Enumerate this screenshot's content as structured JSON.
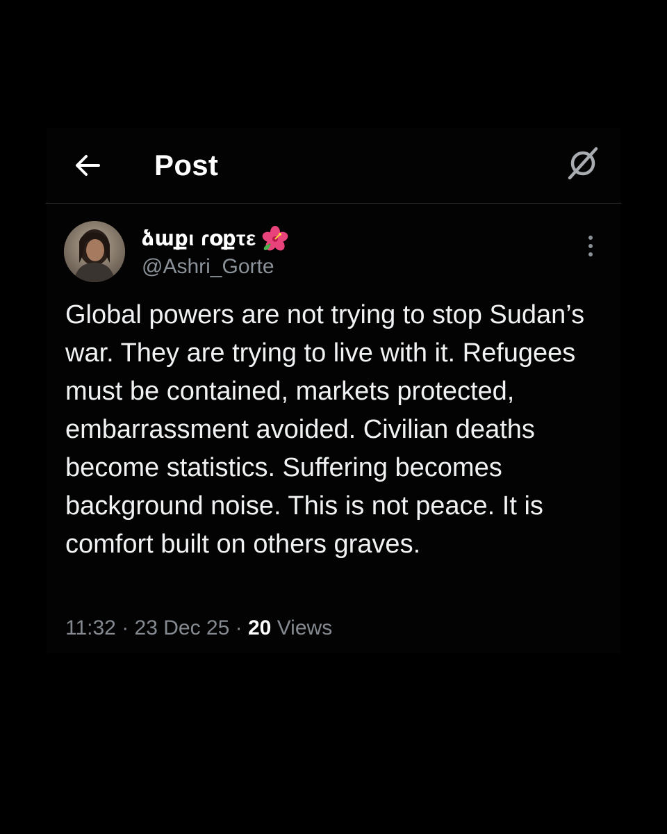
{
  "header": {
    "title": "Post",
    "back_icon": "arrow-left-icon",
    "grok_icon": "grok-icon"
  },
  "post": {
    "author": {
      "display_name": "ձաքι ɾօքτε",
      "emoji_icon": "hibiscus-icon",
      "handle": "@Ashri_Gorte"
    },
    "more_icon": "more-vertical-icon",
    "text": "Global powers are not trying to stop Sudan’s war. They are trying to live with it. Refugees must be contained, markets protected, embarrassment avoided. Civilian deaths become statistics. Suffering becomes background noise. This is not peace. It is comfort built on others graves.",
    "time": "11:32",
    "separator": "·",
    "date": "23 Dec 25",
    "views_count": "20",
    "views_label": "Views"
  },
  "colors": {
    "background": "#000000",
    "text_primary": "#f0f2f3",
    "text_secondary": "#848a90",
    "divider": "#2a2d30"
  }
}
